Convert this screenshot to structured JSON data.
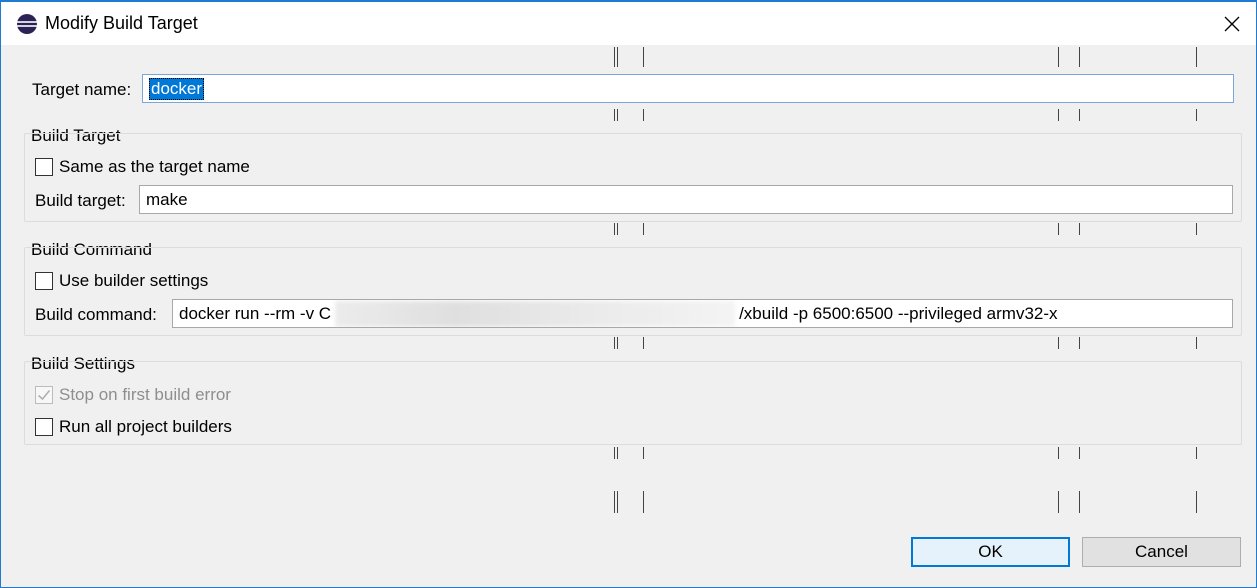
{
  "window": {
    "title": "Modify Build Target",
    "icon": "eclipse-icon",
    "close_icon": "close-icon"
  },
  "target_name": {
    "label": "Target name:",
    "value": "docker"
  },
  "build_target_group": {
    "title": "Build Target",
    "same_as_target": {
      "label": "Same as the target name",
      "checked": false
    },
    "build_target": {
      "label": "Build target:",
      "value": "make"
    }
  },
  "build_command_group": {
    "title": "Build Command",
    "use_builder_settings": {
      "label": "Use builder settings",
      "checked": false
    },
    "build_command": {
      "label": "Build command:",
      "value_prefix": "docker run --rm -v C",
      "value_suffix": "/xbuild -p 6500:6500 --privileged armv32-x"
    }
  },
  "build_settings_group": {
    "title": "Build Settings",
    "stop_on_first_error": {
      "label": "Stop on first build error",
      "checked": true,
      "enabled": false
    },
    "run_all_builders": {
      "label": "Run all project builders",
      "checked": false
    }
  },
  "buttons": {
    "ok": "OK",
    "cancel": "Cancel"
  },
  "colors": {
    "accent": "#0078d7",
    "window_border": "#1f7bd1",
    "dialog_bg": "#f0f0f0"
  }
}
